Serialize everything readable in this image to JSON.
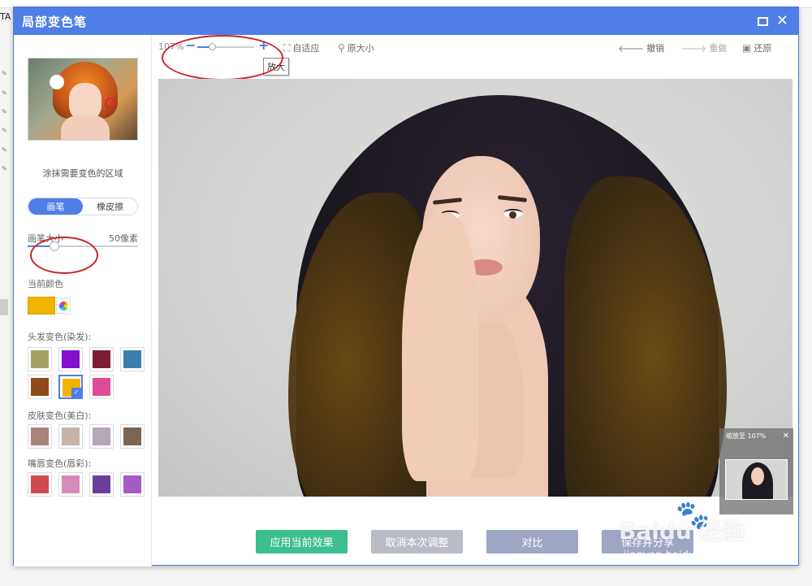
{
  "background_app": {
    "corner_text": "TA"
  },
  "dialog": {
    "title": "局部变色笔",
    "max_icon": "maximize-icon",
    "close_icon": "close-icon",
    "close_glyph": "✕"
  },
  "left_panel": {
    "hint": "涂抹需要变色的区域",
    "tabs": [
      {
        "label": "画笔",
        "active": true
      },
      {
        "label": "橡皮擦",
        "active": false
      }
    ],
    "brush_size_label": "画笔大小",
    "brush_size_value": "50像素",
    "brush_size_fraction": 0.24,
    "current_color_label": "当前颜色",
    "current_color": "#f0b400",
    "hair_label": "头发变色(染发):",
    "hair_colors": [
      "#a4a064",
      "#8410cc",
      "#7d1e34",
      "#3a7fae",
      "#8e4a1c",
      "#f0b400",
      "#de4b98"
    ],
    "skin_label": "皮肤变色(美白):",
    "skin_colors": [
      "#a8837a",
      "#c7b3a8",
      "#b3a7b8",
      "#7b6553"
    ],
    "lip_label": "嘴唇变色(唇彩):",
    "lip_colors": [
      "#cf4b4e",
      "#d88ab8",
      "#6b3e9a",
      "#a55bc4"
    ]
  },
  "toolbar": {
    "zoom_percent": "107%",
    "zoom_minus": "−",
    "zoom_plus": "+",
    "zoom_fraction": 0.26,
    "fit_label": "自适应",
    "actual_size_label": "原大小",
    "undo_label": "撤销",
    "redo_label": "重做",
    "restore_label": "还原",
    "tooltip": "放大"
  },
  "navigator": {
    "label": "缩放至 107%",
    "close_glyph": "✕"
  },
  "buttons": {
    "apply": "应用当前效果",
    "cancel": "取消本次调整",
    "compare": "对比",
    "save": "保存并分享"
  },
  "watermark": {
    "main": "Baidu 经验",
    "sub": "jingyan.baidu.com"
  }
}
